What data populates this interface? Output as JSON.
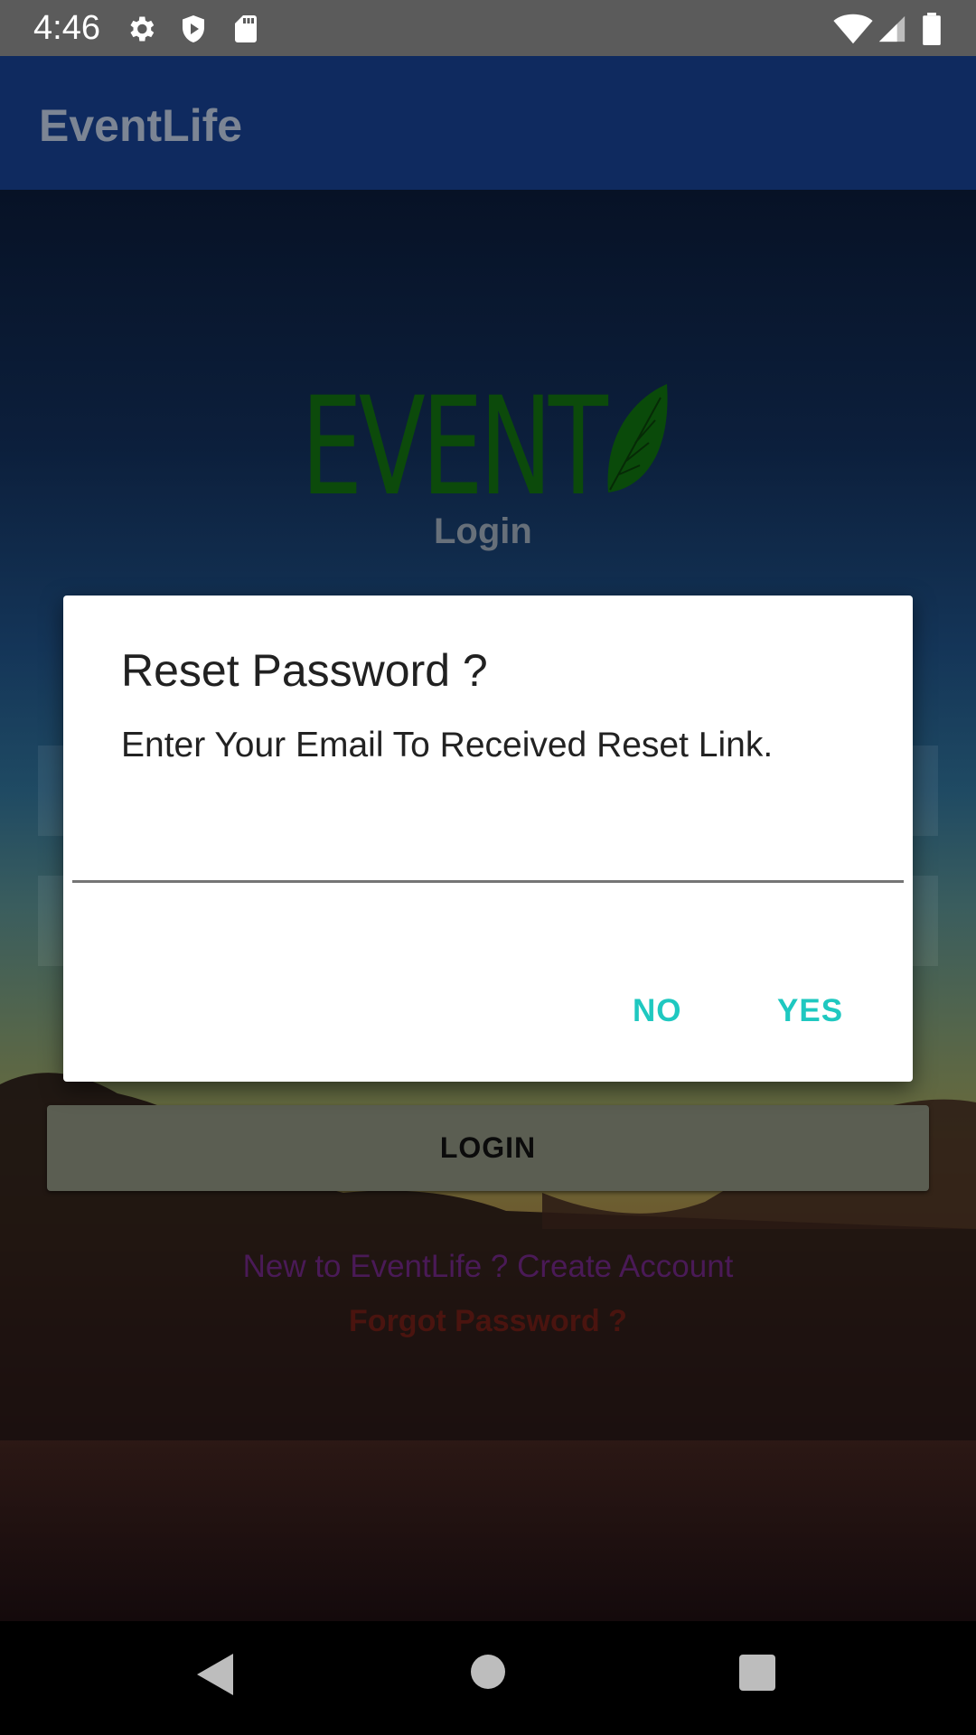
{
  "status_bar": {
    "time": "4:46",
    "icons_left": [
      "gear-icon",
      "shield-icon",
      "sd-card-icon"
    ],
    "icons_right": [
      "wifi-icon",
      "signal-icon",
      "battery-icon"
    ]
  },
  "app_bar": {
    "title": "EventLife"
  },
  "login_screen": {
    "logo_text": "EVENT",
    "subtitle": "Login",
    "login_button": "LOGIN",
    "signup_prompt": "New to EventLife ?  Create Account",
    "forgot_password": "Forgot Password ?"
  },
  "dialog": {
    "title": "Reset Password ?",
    "message": "Enter Your Email To Received Reset Link.",
    "email_value": "",
    "negative_button": "NO",
    "positive_button": "YES",
    "button_color": "#1fc8c0"
  },
  "nav_bar": {
    "icons": [
      "back-icon",
      "home-icon",
      "recents-icon"
    ]
  }
}
